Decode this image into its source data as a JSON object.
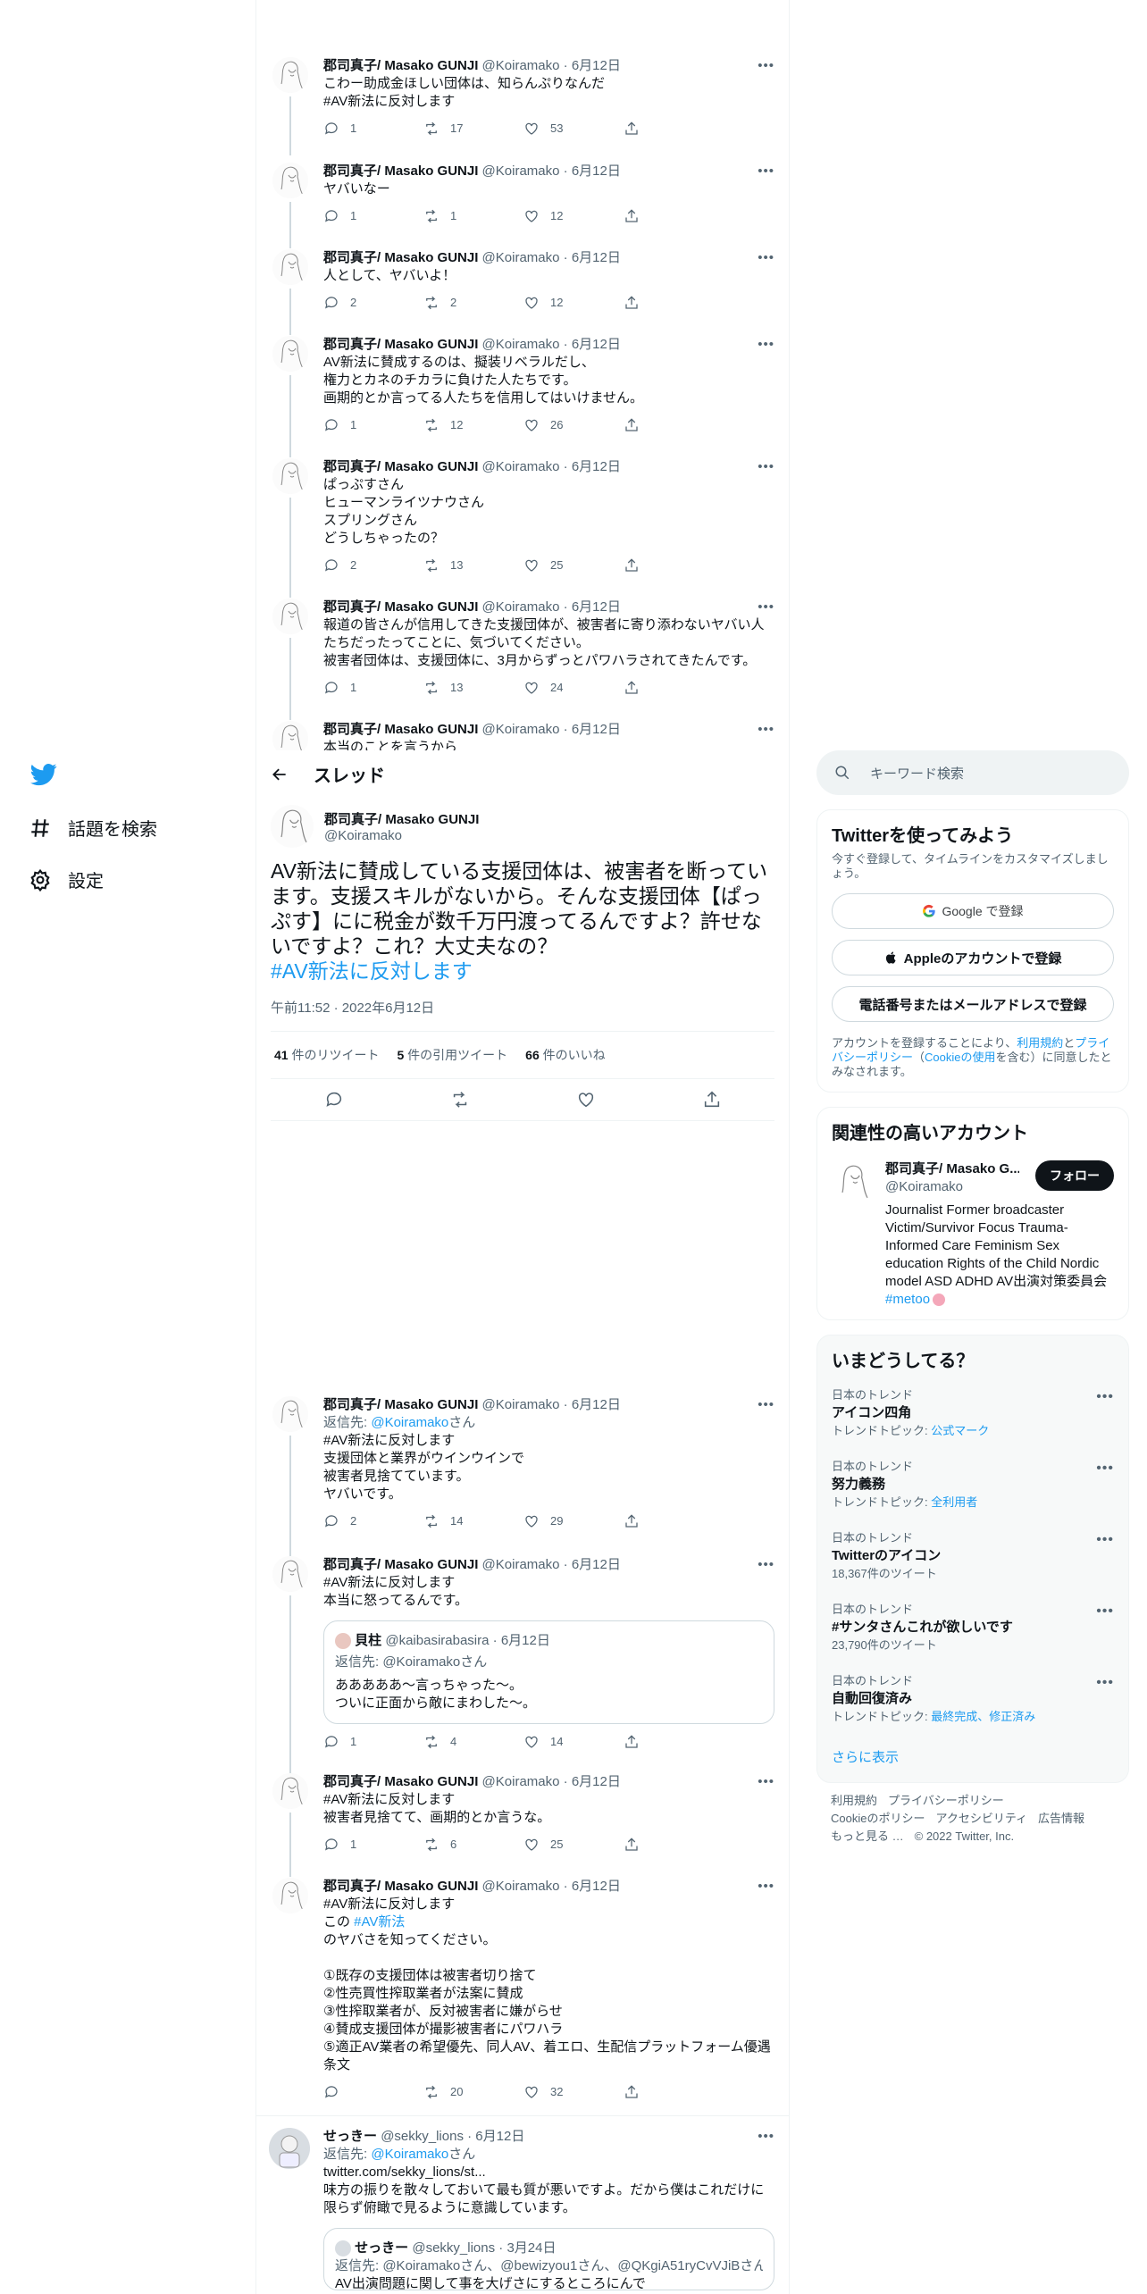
{
  "nav": {
    "items": [
      {
        "label": "話題を検索"
      },
      {
        "label": "設定"
      }
    ]
  },
  "thread": {
    "title": "スレッド"
  },
  "author": {
    "name": "郡司真子/ Masako GUNJI",
    "handle": "@Koiramako",
    "date": "6月12日"
  },
  "top_tweets": [
    {
      "text": "こわー助成金ほしい団体は、知らんぷりなんだ",
      "hashtag": "#AV新法に反対します",
      "reply": "1",
      "rt": "17",
      "like": "53"
    },
    {
      "text": "ヤバいなー",
      "reply": "1",
      "rt": "1",
      "like": "12"
    },
    {
      "text": "人として、ヤバいよ！",
      "reply": "2",
      "rt": "2",
      "like": "12"
    },
    {
      "text": "AV新法に賛成するのは、擬装リベラルだし、\n権力とカネのチカラに負けた人たちです。\n画期的とか言ってる人たちを信用してはいけません。",
      "reply": "1",
      "rt": "12",
      "like": "26"
    },
    {
      "text": "ぱっぷすさん\nヒューマンライツナウさん\nスプリングさん\nどうしちゃったの？",
      "reply": "2",
      "rt": "13",
      "like": "25"
    },
    {
      "text": "報道の皆さんが信用してきた支援団体が、被害者に寄り添わないヤバい人たちだったってことに、気づいてください。\n被害者団体は、支援団体に、3月からずっとパワハラされてきたんです。",
      "reply": "1",
      "rt": "13",
      "like": "24"
    },
    {
      "text": "本当のことを言うから"
    }
  ],
  "main_tweet": {
    "name": "郡司真子/ Masako GUNJI",
    "handle": "@Koiramako",
    "text": "AV新法に賛成している支援団体は、被害者を断っています。支援スキルがないから。そんな支援団体【ぱっぷす】にに税金が数千万円渡ってるんですよ？許せないですよ？これ？大丈夫なの？",
    "hashtag": "#AV新法に反対します",
    "time": "午前11:52 · 2022年6月12日",
    "retweets": "41",
    "retweets_label": "件のリツイート",
    "quotes": "5",
    "quotes_label": "件の引用ツイート",
    "likes": "66",
    "likes_label": "件のいいね"
  },
  "replies": [
    {
      "reply_to_prefix": "返信先: ",
      "reply_to": "@Koiramako",
      "reply_to_suffix": "さん",
      "hashtag": "#AV新法に反対します",
      "text": "支援団体と業界がウインウインで\n被害者見捨てています。\nヤバいです。",
      "reply": "2",
      "rt": "14",
      "like": "29"
    },
    {
      "hashtag": "#AV新法に反対します",
      "text": "本当に怒ってるんです。",
      "quote": {
        "name": "貝柱",
        "handle": "@kaibasirabasira",
        "date": "6月12日",
        "reply_to": "返信先: @Koiramakoさん",
        "text": "あああああ〜言っちゃった〜。\nついに正面から敵にまわした〜。"
      },
      "reply": "1",
      "rt": "4",
      "like": "14"
    },
    {
      "hashtag": "#AV新法に反対します",
      "text": "被害者見捨てて、画期的とか言うな。",
      "reply": "1",
      "rt": "6",
      "like": "25"
    },
    {
      "hashtag": "#AV新法に反対します",
      "text_pre": "この ",
      "inline_tag": "#AV新法",
      "text": "のヤバさを知ってください。\n\n①既存の支援団体は被害者切り捨て\n②性売買性搾取業者が法案に賛成\n③性搾取業者が、反対被害者に嫌がらせ\n④賛成支援団体が撮影被害者にパワハラ\n⑤適正AV業者の希望優先、同人AV、着エロ、生配信プラットフォーム優遇条文",
      "reply": "",
      "rt": "20",
      "like": "32"
    }
  ],
  "sekky": {
    "name": "せっきー",
    "handle": "@sekky_lions",
    "date": "6月12日",
    "reply_to": "@Koiramako",
    "link": "twitter.com/sekky_lions/st...",
    "text": "味方の振りを散々しておいて最も質が悪いですよ。だから僕はこれだけに限らず俯瞰で見るように意識しています。",
    "quote": {
      "name": "せっきー",
      "handle": "@sekky_lions",
      "date": "3月24日",
      "reply_to": "返信先: @Koiramakoさん、@bewizyou1さん、@QKgiA51ryCvVJiBさん",
      "text": "AV出演問題に関して事を大げさにするところにんで"
    }
  },
  "right": {
    "search_placeholder": "キーワード検索",
    "signup_title": "Twitterを使ってみよう",
    "signup_sub": "今すぐ登録して、タイムラインをカスタマイズしましょう。",
    "google_btn": "Google で登録",
    "apple_btn": "Appleのアカウントで登録",
    "phone_btn": "電話番号またはメールアドレスで登録",
    "terms_pre": "アカウントを登録することにより、",
    "terms_link1": "利用規約",
    "terms_and": "と",
    "terms_link2": "プライバシーポリシー",
    "terms_paren_open": "（",
    "terms_link3": "Cookieの使用",
    "terms_post": "を含む）に同意したとみなされます。",
    "related_title": "関連性の高いアカウント",
    "related_name": "郡司真子/ Masako G...",
    "related_handle": "@Koiramako",
    "follow_btn": "フォロー",
    "related_bio": "Journalist Former broadcaster Victim/Survivor Focus Trauma-Informed Care Feminism Sex education Rights of the Child Nordic model ASD ADHD AV出演対策委員会",
    "related_tag": "#metoo",
    "trends_title": "いまどうしてる？",
    "trends": [
      {
        "ctx": "日本のトレンド",
        "name": "アイコン四角",
        "sub_pre": "トレンドトピック: ",
        "sub_link": "公式マーク"
      },
      {
        "ctx": "日本のトレンド",
        "name": "努力義務",
        "sub_pre": "トレンドトピック: ",
        "sub_link": "全利用者"
      },
      {
        "ctx": "日本のトレンド",
        "name": "Twitterのアイコン",
        "sub_pre": "18,367件のツイート",
        "sub_link": ""
      },
      {
        "ctx": "日本のトレンド",
        "name": "#サンタさんこれが欲しいです",
        "sub_pre": "23,790件のツイート",
        "sub_link": ""
      },
      {
        "ctx": "日本のトレンド",
        "name": "自動回復済み",
        "sub_pre": "トレンドトピック: ",
        "sub_link": "最終完成、修正済み"
      }
    ],
    "show_more": "さらに表示",
    "footer": [
      "利用規約",
      "プライバシーポリシー",
      "Cookieのポリシー",
      "アクセシビリティ",
      "広告情報",
      "もっと見る …",
      "© 2022 Twitter, Inc."
    ]
  },
  "colors": {
    "accent": "#1d9bf0",
    "text": "#0f1419",
    "muted": "#536471"
  }
}
